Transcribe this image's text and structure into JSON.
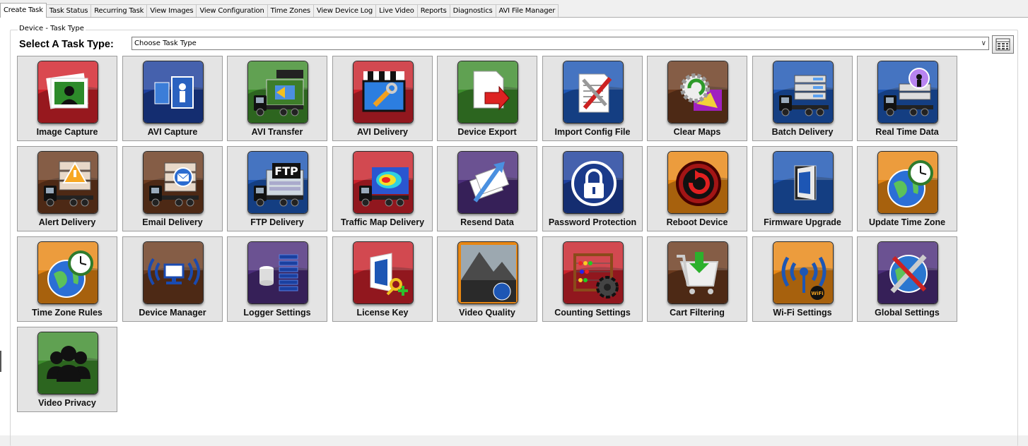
{
  "tabs": [
    {
      "label": "Create Task",
      "active": true
    },
    {
      "label": "Task Status"
    },
    {
      "label": "Recurring Task"
    },
    {
      "label": "View Images"
    },
    {
      "label": "View Configuration"
    },
    {
      "label": "Time Zones"
    },
    {
      "label": "View Device Log"
    },
    {
      "label": "Live Video"
    },
    {
      "label": "Reports"
    },
    {
      "label": "Diagnostics"
    },
    {
      "label": "AVI File Manager"
    }
  ],
  "group": {
    "title": "Device - Task Type",
    "select_label": "Select A Task Type:",
    "select_value": "Choose Task Type"
  },
  "tiles": [
    {
      "label": "Image Capture",
      "icon": "photo-icon",
      "color": "#d2222a"
    },
    {
      "label": "AVI Capture",
      "icon": "video-capture-icon",
      "color": "#1d3f9c"
    },
    {
      "label": "AVI Transfer",
      "icon": "truck-transfer-icon",
      "color": "#3f8d2c"
    },
    {
      "label": "AVI Delivery",
      "icon": "clapperboard-wrench-icon",
      "color": "#c9212a"
    },
    {
      "label": "Device Export",
      "icon": "file-export-icon",
      "color": "#3d8d2c"
    },
    {
      "label": "Import Config File",
      "icon": "config-tools-icon",
      "color": "#1d56b4"
    },
    {
      "label": "Clear Maps",
      "icon": "refresh-map-icon",
      "color": "#6b3a1e"
    },
    {
      "label": "Batch Delivery",
      "icon": "truck-server-icon",
      "color": "#1d56b4"
    },
    {
      "label": "Real Time Data",
      "icon": "truck-broadcast-icon",
      "color": "#1d56b4"
    },
    {
      "label": "Alert Delivery",
      "icon": "truck-alert-icon",
      "color": "#6b3a1e"
    },
    {
      "label": "Email Delivery",
      "icon": "truck-email-icon",
      "color": "#6b3a1e"
    },
    {
      "label": "FTP Delivery",
      "icon": "truck-ftp-icon",
      "color": "#1d56b4"
    },
    {
      "label": "Traffic Map Delivery",
      "icon": "truck-heatmap-icon",
      "color": "#c9212a"
    },
    {
      "label": "Resend Data",
      "icon": "resend-icon",
      "color": "#4b2d7a"
    },
    {
      "label": "Password Protection",
      "icon": "padlock-icon",
      "color": "#1d3f9c"
    },
    {
      "label": "Reboot Device",
      "icon": "reboot-icon",
      "color": "#e88713"
    },
    {
      "label": "Firmware Upgrade",
      "icon": "firmware-icon",
      "color": "#1d56b4"
    },
    {
      "label": "Update Time Zone",
      "icon": "globe-clock-icon",
      "color": "#e88713"
    },
    {
      "label": "Time Zone Rules",
      "icon": "globe-clock-icon",
      "color": "#e88713"
    },
    {
      "label": "Device Manager",
      "icon": "network-device-icon",
      "color": "#6b3a1e"
    },
    {
      "label": "Logger Settings",
      "icon": "database-icon",
      "color": "#4b2d7a"
    },
    {
      "label": "License Key",
      "icon": "license-key-icon",
      "color": "#c9212a"
    },
    {
      "label": "Video Quality",
      "icon": "landscape-icon",
      "color": "#e88713"
    },
    {
      "label": "Counting Settings",
      "icon": "abacus-icon",
      "color": "#c9212a"
    },
    {
      "label": "Cart Filtering",
      "icon": "cart-icon",
      "color": "#6b3a1e"
    },
    {
      "label": "Wi-Fi Settings",
      "icon": "wifi-icon",
      "color": "#e88713"
    },
    {
      "label": "Global Settings",
      "icon": "globe-tools-icon",
      "color": "#4b2d7a"
    },
    {
      "label": "Video Privacy",
      "icon": "people-icon",
      "color": "#3d8d2c"
    }
  ],
  "icon_text": {
    "ftp": "FTP",
    "wifi": "WiFi"
  }
}
